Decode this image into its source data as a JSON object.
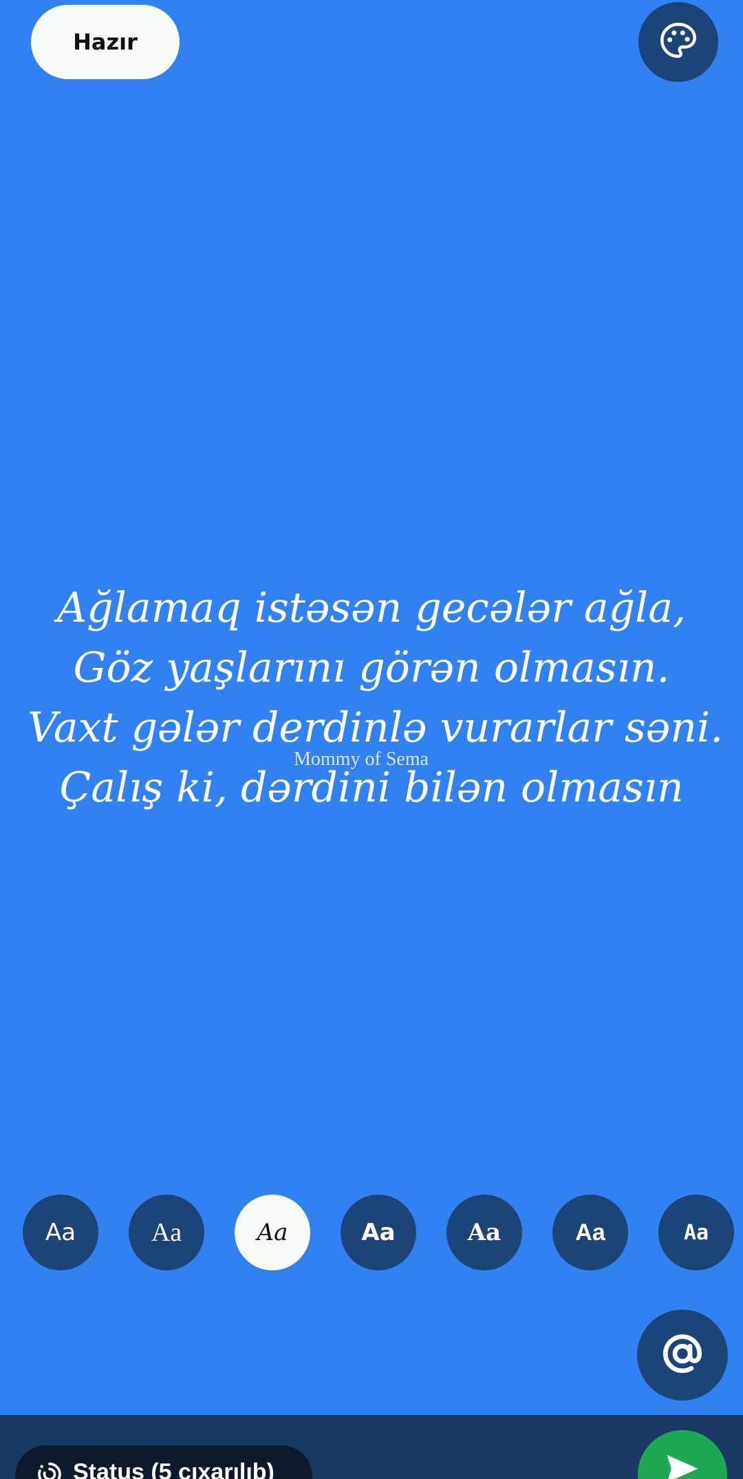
{
  "header": {
    "done_label": "Hazır",
    "palette_icon": "palette-icon"
  },
  "quote": {
    "lines": [
      "Ağlamaq istəsən gecələr ağla,",
      "Göz yaşlarını görən olmasın.",
      "Vaxt gələr derdinlə vurarlar səni.",
      "Çalış ki, dərdini bilən olmasın"
    ],
    "watermark": "Mommy of Sema"
  },
  "fonts": {
    "options": [
      {
        "label": "Aa",
        "style": "sans"
      },
      {
        "label": "Aa",
        "style": "serif"
      },
      {
        "label": "Aa",
        "style": "script"
      },
      {
        "label": "Aa",
        "style": "rounded"
      },
      {
        "label": "Aa",
        "style": "slab"
      },
      {
        "label": "Aa",
        "style": "bold"
      },
      {
        "label": "Aa",
        "style": "mono"
      }
    ],
    "selected_index": 2
  },
  "mention": {
    "icon": "at-icon"
  },
  "bottom": {
    "status_label": "Status (5 çıxarılıb)",
    "status_icon": "status-icon",
    "send_icon": "send-icon"
  },
  "colors": {
    "background": "#3281f0",
    "button_dark": "#1d4479",
    "button_light": "#f6faf4",
    "bottom_bar": "#183b64",
    "send": "#1da851"
  }
}
